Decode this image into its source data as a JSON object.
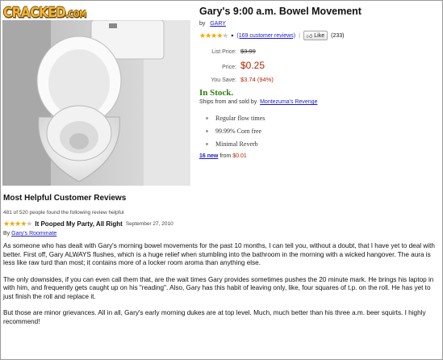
{
  "logo": {
    "text": "CRACKED",
    "suffix": ".COM"
  },
  "product": {
    "title": "Gary's 9:00 a.m. Bowel Movement",
    "by_prefix": "by",
    "author": "GARY",
    "rating_stars": 4,
    "rating_max": 5,
    "reviews_link": "(169 customer reviews)",
    "separator": "|",
    "like_label": "Like",
    "like_count": "(233)"
  },
  "pricing": {
    "list_label": "List Price:",
    "list_price": "$3.99",
    "price_label": "Price:",
    "price": "$0.25",
    "save_label": "You Save:",
    "save_value": "$3.74 (94%)"
  },
  "availability": {
    "status": "In Stock.",
    "ships_text": "Ships from and sold by",
    "seller": "Montezuma's Revenge"
  },
  "features": [
    "Regular flow times",
    "99.99% Corn free",
    "Minimal Reverb"
  ],
  "offers": {
    "new_link": "16 new",
    "from_text": "from",
    "from_price": "$0.01"
  },
  "reviews": {
    "heading": "Most Helpful Customer Reviews",
    "helpful_text": "481 of 520 people found the following review helpful",
    "stars": 4,
    "title": "It Pooped My Party, All Right",
    "date": "September 27, 2010",
    "by_prefix": "By",
    "reviewer": "Gary's Roommate",
    "paragraphs": [
      "As someone who has dealt with Gary's morning bowel movements for the past 10 months, I can tell you, without a doubt, that I have yet to deal with better. First off, Gary ALWAYS flushes, which is a huge relief when stumbling into the bathroom in the morning with a wicked hangover. The aura is less like raw turd than most; it contains more of a locker room aroma than anything else.",
      "The only downsides, if you can even call them that, are the wait times Gary provides sometimes pushes the 20 minute mark. He brings his laptop in with him, and frequently gets caught up on his \"reading\". Also, Gary has this habit of leaving only, like, four squares of t.p. on the roll. He has yet to just finish the roll and replace it.",
      "But those are minor grievances. All in all, Gary's early morning dukes are at top level. Much, much better than his three a.m. beer squirts. I highly recommend!"
    ]
  },
  "colors": {
    "price": "#b12704",
    "link": "#1a1acc",
    "in_stock": "#2e7d12",
    "star": "#f0a800",
    "logo": "#f4b632"
  }
}
